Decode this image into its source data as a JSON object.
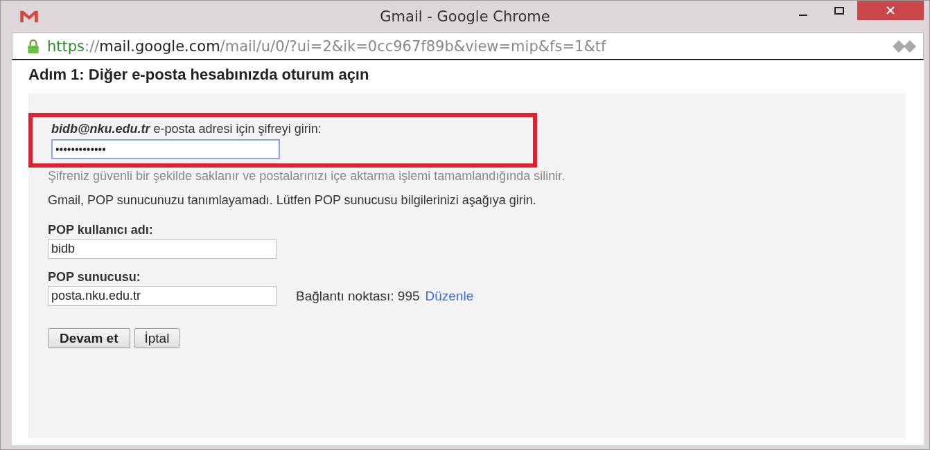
{
  "window": {
    "title": "Gmail - Google Chrome"
  },
  "address_bar": {
    "scheme": "https",
    "separator": "://",
    "host": "mail.google.com",
    "path": "/mail/u/0/?ui=2&ik=0cc967f89b&view=mip&fs=1&tf"
  },
  "heading": "Adım 1: Diğer e-posta hesabınızda oturum açın",
  "password_prompt": {
    "label": "**bidb@nku.edu.tr** e-posta adresi için şifreyi girin:",
    "value": "•••••••••••••",
    "highlighted": true
  },
  "note": "Şifreniz güvenli bir şekilde saklanır ve postalarınızı içe aktarma işlemi tamamlandığında silinir.",
  "message": "Gmail, POP sunucunuzu tanımlayamadı. Lütfen POP sunucusu bilgilerinizi aşağıya girin.",
  "username": {
    "label": "POP kullanıcı adı:",
    "value": "bidb"
  },
  "server": {
    "label": "POP sunucusu:",
    "value": "posta.nku.edu.tr",
    "port_text": "Bağlantı noktası: 995",
    "edit_link": "Düzenle"
  },
  "buttons": [
    "Devam et",
    "İptal"
  ]
}
